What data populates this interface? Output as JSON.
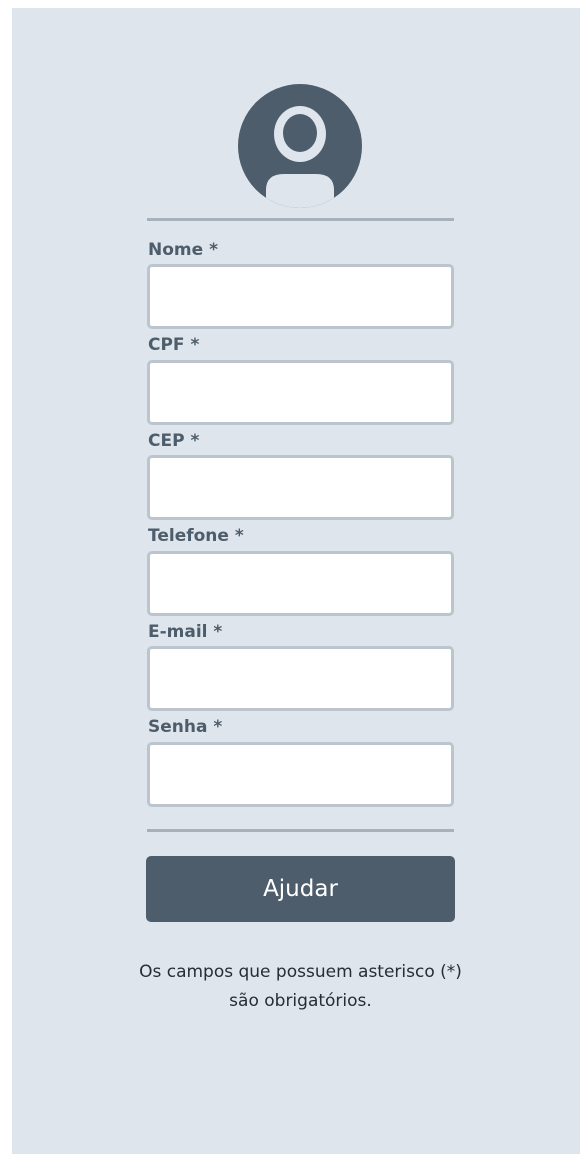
{
  "form": {
    "fields": [
      {
        "label": "Nome *",
        "value": "",
        "placeholder": ""
      },
      {
        "label": "CPF *",
        "value": "",
        "placeholder": ""
      },
      {
        "label": "CEP *",
        "value": "",
        "placeholder": ""
      },
      {
        "label": "Telefone *",
        "value": "",
        "placeholder": ""
      },
      {
        "label": "E-mail *",
        "value": "",
        "placeholder": ""
      },
      {
        "label": "Senha *",
        "value": "",
        "placeholder": ""
      }
    ],
    "submit_label": "Ajudar"
  },
  "note": {
    "line1": "Os campos que possuem asterisco (*)",
    "line2": "são obrigatórios."
  },
  "icons": {
    "avatar": "user-circle-icon"
  },
  "colors": {
    "background": "#dfe5ed",
    "accent": "#4d5d6b",
    "divider": "#a7b1bc",
    "input_border": "#bcc4cd"
  }
}
